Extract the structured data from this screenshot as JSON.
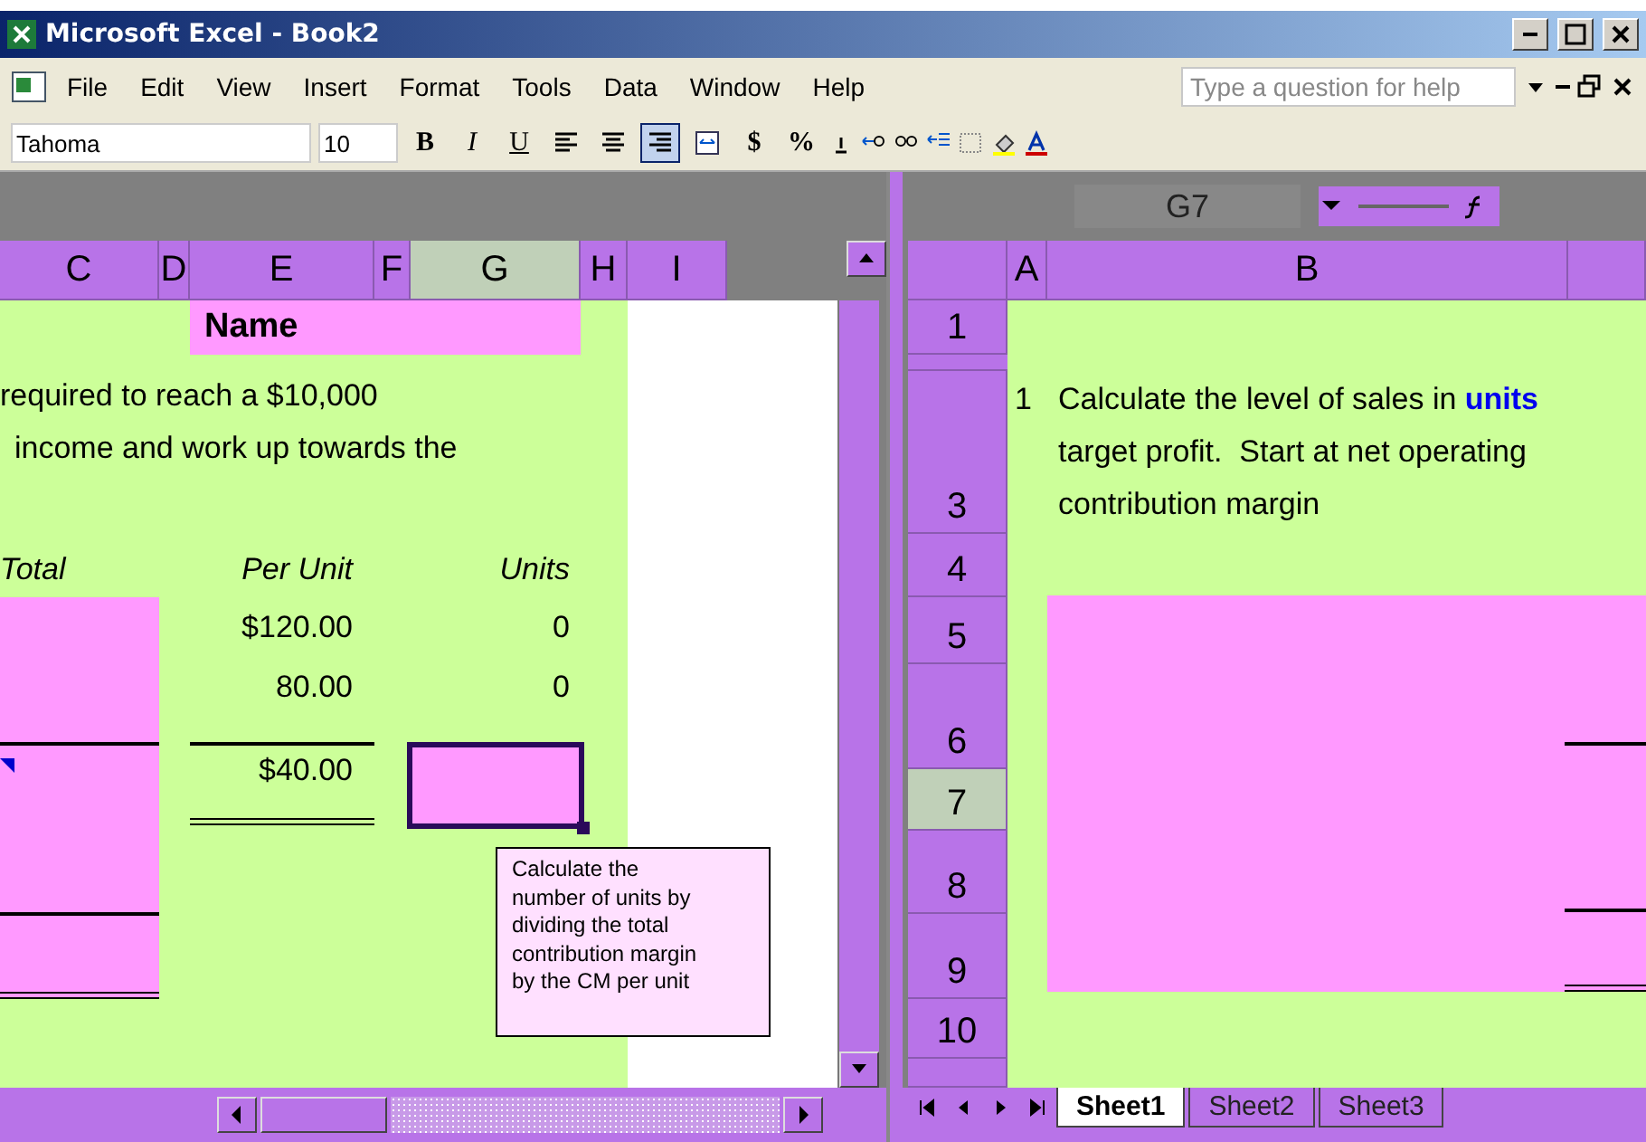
{
  "window": {
    "title": "Microsoft Excel - Book2"
  },
  "menu": [
    "File",
    "Edit",
    "View",
    "Insert",
    "Format",
    "Tools",
    "Data",
    "Window",
    "Help"
  ],
  "help_box": {
    "placeholder": "Type a question for help"
  },
  "toolbar": {
    "font": "Tahoma",
    "size": "10",
    "styles": [
      "B",
      "I",
      "U"
    ],
    "align_buttons": [
      {
        "kind": "left",
        "selected": false
      },
      {
        "kind": "center",
        "selected": false
      },
      {
        "kind": "right",
        "selected": true
      },
      {
        "kind": "merge",
        "selected": false
      }
    ],
    "number_buttons": [
      "$",
      "%"
    ]
  },
  "left_pane": {
    "columns": [
      {
        "label": "C",
        "selected": false
      },
      {
        "label": "D",
        "selected": false
      },
      {
        "label": "E",
        "selected": false
      },
      {
        "label": "F",
        "selected": false
      },
      {
        "label": "G",
        "selected": true
      },
      {
        "label": "H",
        "selected": false
      },
      {
        "label": "I",
        "selected": false
      }
    ],
    "name_cell": "Name",
    "instructions": [
      "required to reach a $10,000",
      "income and work up towards the"
    ],
    "headers": {
      "total": "Total",
      "per_unit": "Per Unit",
      "units": "Units"
    },
    "rows": [
      {
        "per_unit": "$120.00",
        "units": "0"
      },
      {
        "per_unit": "80.00",
        "units": "0"
      }
    ],
    "cm_per_unit": "$40.00",
    "comment": "Calculate the number of units by dividing the total contribution margin by the CM per unit"
  },
  "right_pane": {
    "name_box": "G7",
    "columns": [
      {
        "label": "A"
      },
      {
        "label": "B"
      }
    ],
    "rows": [
      {
        "label": "1",
        "selected": false
      },
      {
        "label": "3",
        "selected": false
      },
      {
        "label": "4",
        "selected": false
      },
      {
        "label": "5",
        "selected": false
      },
      {
        "label": "6",
        "selected": false
      },
      {
        "label": "7",
        "selected": true
      },
      {
        "label": "8",
        "selected": false
      },
      {
        "label": "9",
        "selected": false
      },
      {
        "label": "10",
        "selected": false
      }
    ],
    "item_number": "1",
    "instructions": [
      "Calculate the level of sales in **units**",
      "target profit.  Start at net operating",
      "contribution margin"
    ],
    "sheet_tabs": [
      {
        "label": "Sheet1",
        "selected": true
      },
      {
        "label": "Sheet2",
        "selected": false
      },
      {
        "label": "Sheet3",
        "selected": false
      }
    ]
  }
}
